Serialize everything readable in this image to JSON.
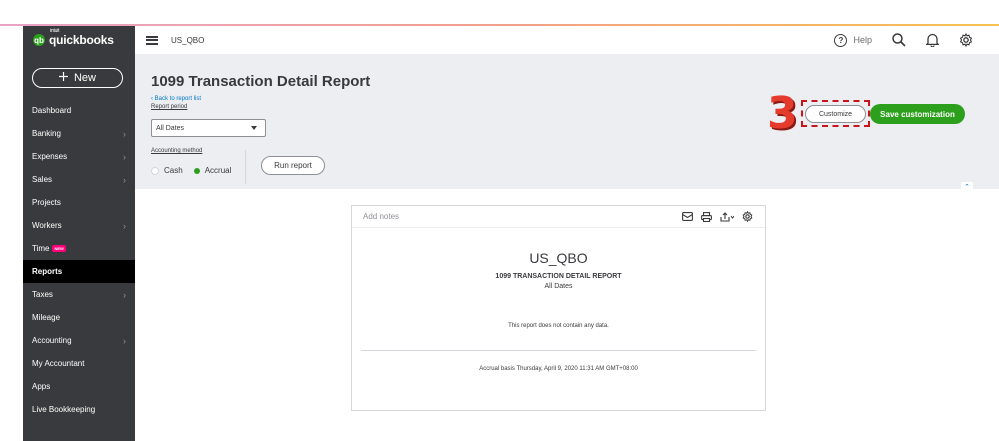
{
  "brand": {
    "logo_small": "intuit",
    "logo": "quickbooks",
    "logo_mark": "qb"
  },
  "sidebar": {
    "new_button": "New",
    "new_icon": "plus-icon",
    "items": [
      {
        "label": "Dashboard",
        "chevron": false
      },
      {
        "label": "Banking",
        "chevron": true
      },
      {
        "label": "Expenses",
        "chevron": true
      },
      {
        "label": "Sales",
        "chevron": true
      },
      {
        "label": "Projects",
        "chevron": false
      },
      {
        "label": "Workers",
        "chevron": true
      },
      {
        "label": "Time",
        "chevron": false,
        "badge": "NEW"
      },
      {
        "label": "Reports",
        "chevron": false,
        "active": true
      },
      {
        "label": "Taxes",
        "chevron": true
      },
      {
        "label": "Mileage",
        "chevron": false
      },
      {
        "label": "Accounting",
        "chevron": true
      },
      {
        "label": "My Accountant",
        "chevron": false
      },
      {
        "label": "Apps",
        "chevron": false
      },
      {
        "label": "Live Bookkeeping",
        "chevron": false
      }
    ]
  },
  "topbar": {
    "company": "US_QBO",
    "help_label": "Help",
    "help_glyph": "?",
    "icons": [
      "help-icon",
      "search-icon",
      "bell-icon",
      "gear-icon"
    ]
  },
  "header": {
    "title": "1099 Transaction Detail Report",
    "back_link": "Back to report list",
    "report_period_label": "Report period",
    "report_period_value": "All Dates",
    "accounting_method_label": "Accounting method",
    "method_cash": "Cash",
    "method_accrual": "Accrual",
    "selected_method": "Accrual",
    "run_report": "Run report",
    "customize": "Customize",
    "save_customization": "Save customization",
    "step_number": "3"
  },
  "report": {
    "add_notes": "Add notes",
    "icons": [
      "email-icon",
      "print-icon",
      "export-icon",
      "settings-icon"
    ],
    "company": "US_QBO",
    "title": "1099 TRANSACTION DETAIL REPORT",
    "dates": "All Dates",
    "empty_message": "This report does not contain any data.",
    "footer": "Accrual basis  Thursday, April 9, 2020  11:31 AM GMT+08:00"
  },
  "colors": {
    "sidebar_bg": "#393a3d",
    "accent_green": "#2ca01c",
    "header_bg": "#eceef1",
    "step_red": "#e53b2c",
    "link_blue": "#0077c5"
  }
}
